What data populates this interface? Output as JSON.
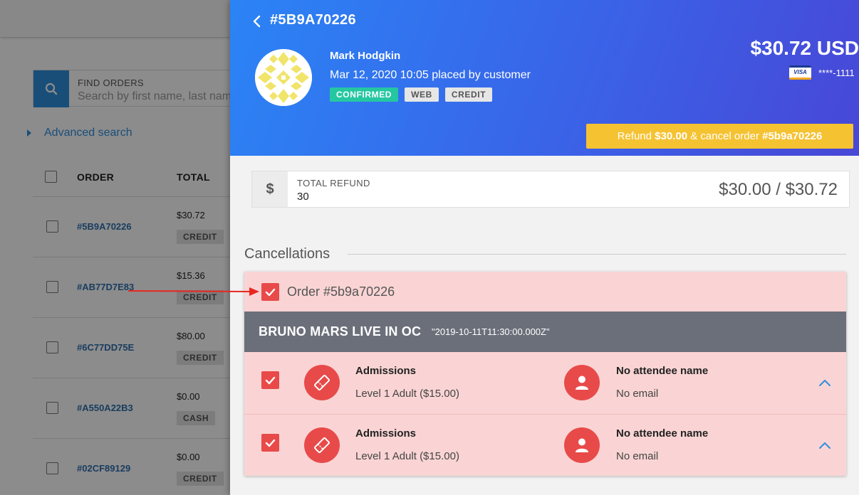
{
  "background": {
    "search": {
      "label": "FIND ORDERS",
      "placeholder": "Search by first name, last name"
    },
    "advanced_search_label": "Advanced search",
    "table_headers": {
      "order": "ORDER",
      "total": "TOTAL"
    },
    "orders": [
      {
        "id": "#5B9A70226",
        "total": "$30.72",
        "payment": "CREDIT"
      },
      {
        "id": "#AB77D7E83",
        "total": "$15.36",
        "payment": "CREDIT"
      },
      {
        "id": "#6C77DD75E",
        "total": "$80.00",
        "payment": "CREDIT"
      },
      {
        "id": "#A550A22B3",
        "total": "$0.00",
        "payment": "CASH"
      },
      {
        "id": "#02CF89129",
        "total": "$0.00",
        "payment": "CREDIT"
      }
    ]
  },
  "drawer": {
    "order_title": "#5B9A70226",
    "customer_name": "Mark Hodgkin",
    "placed_meta": "Mar 12, 2020 10:05 placed by customer",
    "tags": {
      "status": "CONFIRMED",
      "channel": "WEB",
      "payment": "CREDIT"
    },
    "amount": "$30.72 USD",
    "card": {
      "brand": "VISA",
      "masked_number": "****-1111"
    },
    "refund_button": {
      "prefix": "Refund ",
      "amount": "$30.00",
      "middle": " & cancel order ",
      "order": "#5b9a70226"
    },
    "total_refund": {
      "currency_symbol": "$",
      "label": "TOTAL REFUND",
      "value": "30",
      "ratio": "$30.00 / $30.72"
    },
    "cancellations": {
      "title": "Cancellations",
      "order_label": "Order #5b9a70226",
      "event_name": "BRUNO MARS LIVE IN OC",
      "event_date": "\"2019-10-11T11:30:00.000Z\"",
      "tickets": [
        {
          "title": "Admissions",
          "level": "Level 1 Adult ($15.00)",
          "attendee": "No attendee name",
          "email": "No email"
        },
        {
          "title": "Admissions",
          "level": "Level 1 Adult ($15.00)",
          "attendee": "No attendee name",
          "email": "No email"
        }
      ]
    }
  },
  "colors": {
    "header_gradient_start": "#2b84f5",
    "header_gradient_end": "#4847d6",
    "refund_button": "#f5c232",
    "confirmed_tag": "#25c7a1",
    "cancel_card_bg": "#fad4d4",
    "accent_red": "#e84a4a",
    "event_band": "#6b6f7a",
    "link_blue": "#2f8fdc",
    "annotation_arrow": "#e8271f"
  },
  "icons": {
    "back": "chevron-left-icon",
    "search": "search-icon",
    "ticket": "ticket-icon",
    "person": "person-icon",
    "collapse": "chevron-up-icon",
    "checkbox": "check-icon"
  }
}
